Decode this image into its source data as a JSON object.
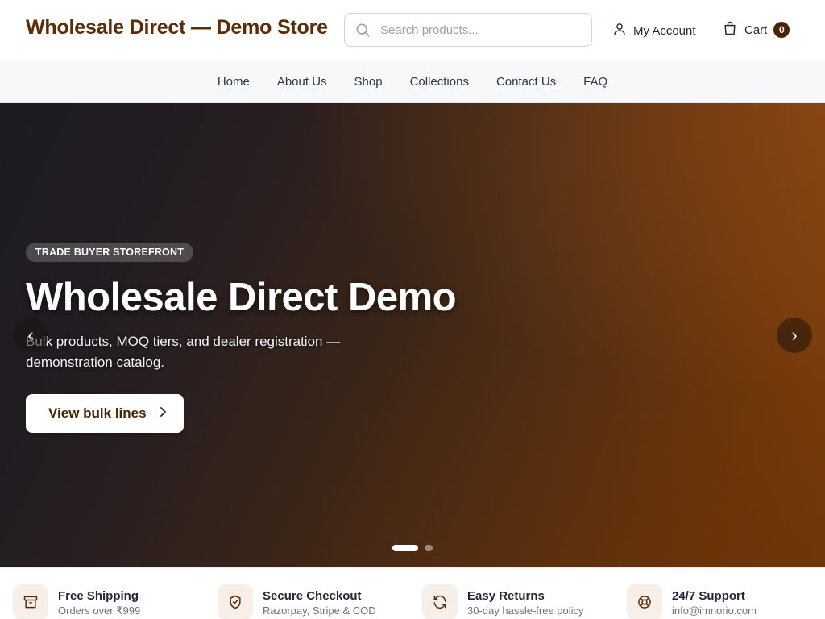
{
  "header": {
    "logo": "Wholesale Direct — Demo Store",
    "search_placeholder": "Search products...",
    "account_label": "My Account",
    "cart_label": "Cart",
    "cart_count": "0"
  },
  "nav": {
    "items": [
      "Home",
      "About Us",
      "Shop",
      "Collections",
      "Contact Us",
      "FAQ"
    ]
  },
  "hero": {
    "eyebrow": "TRADE BUYER STOREFRONT",
    "title": "Wholesale Direct Demo",
    "subtitle": "Bulk products, MOQ tiers, and dealer registration — demonstration catalog.",
    "cta_label": "View bulk lines",
    "prev_arrow": "‹",
    "next_arrow": "›",
    "slide_count": 2,
    "active_slide": 1
  },
  "features": [
    {
      "title": "Free Shipping",
      "subtitle": "Orders over ₹999",
      "icon": "box-icon"
    },
    {
      "title": "Secure Checkout",
      "subtitle": "Razorpay, Stripe & COD",
      "icon": "shield-check-icon"
    },
    {
      "title": "Easy Returns",
      "subtitle": "30-day hassle-free policy",
      "icon": "refresh-icon"
    },
    {
      "title": "24/7 Support",
      "subtitle": "info@imnorio.com",
      "icon": "lifebuoy-icon"
    }
  ],
  "colors": {
    "brand": "#5b2c06",
    "badge": "#4a2306",
    "icon_bg": "#f7efe8",
    "icon_stroke": "#5b2c06"
  }
}
